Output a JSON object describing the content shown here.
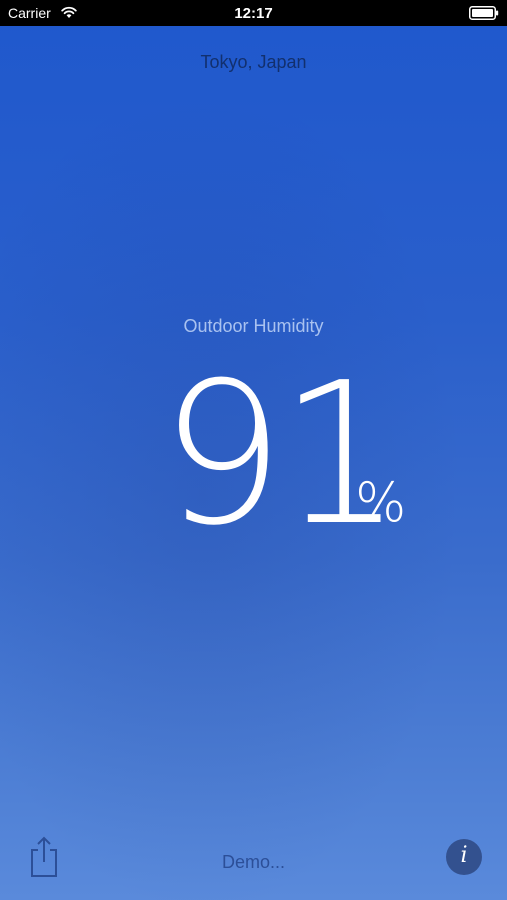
{
  "status_bar": {
    "carrier": "Carrier",
    "time": "12:17",
    "icons": [
      "wifi-icon",
      "battery-icon"
    ]
  },
  "location": {
    "name": "Tokyo, Japan"
  },
  "metric": {
    "label": "Outdoor Humidity",
    "value": "91",
    "unit": "%"
  },
  "footer": {
    "status_text": "Demo...",
    "share_icon": "share-icon",
    "info_icon": "info-icon",
    "info_glyph": "i"
  },
  "colors": {
    "background_top": "#1f58cd",
    "background_bottom": "#5a8adb",
    "location_text": "#12306e",
    "label_text": "#a9c2f0",
    "value_text": "#ffffff",
    "info_button": "#33518f"
  }
}
